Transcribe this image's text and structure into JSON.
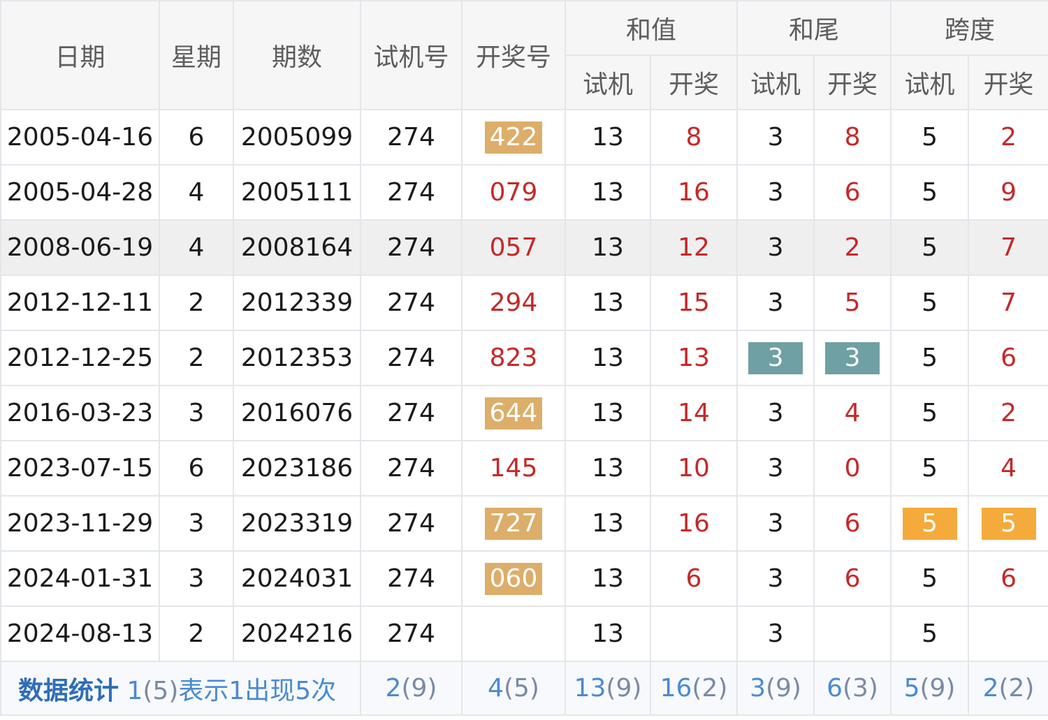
{
  "headers": {
    "date": "日期",
    "weekday": "星期",
    "issue": "期数",
    "test_no": "试机号",
    "draw_no": "开奖号",
    "sum": "和值",
    "sum_tail": "和尾",
    "span": "跨度",
    "sub_test": "试机",
    "sub_draw": "开奖"
  },
  "rows": [
    {
      "date": "2005-04-16",
      "weekday": "6",
      "issue": "2005099",
      "test": "274",
      "draw": "422",
      "draw_badge": "sand",
      "sum_test": "13",
      "sum_draw": "8",
      "tail_test": "3",
      "tail_draw": "8",
      "span_test": "5",
      "span_draw": "2"
    },
    {
      "date": "2005-04-28",
      "weekday": "4",
      "issue": "2005111",
      "test": "274",
      "draw": "079",
      "draw_badge": "",
      "sum_test": "13",
      "sum_draw": "16",
      "tail_test": "3",
      "tail_draw": "6",
      "span_test": "5",
      "span_draw": "9"
    },
    {
      "date": "2008-06-19",
      "weekday": "4",
      "issue": "2008164",
      "test": "274",
      "draw": "057",
      "draw_badge": "",
      "sum_test": "13",
      "sum_draw": "12",
      "tail_test": "3",
      "tail_draw": "2",
      "span_test": "5",
      "span_draw": "7",
      "highlight": true
    },
    {
      "date": "2012-12-11",
      "weekday": "2",
      "issue": "2012339",
      "test": "274",
      "draw": "294",
      "draw_badge": "",
      "sum_test": "13",
      "sum_draw": "15",
      "tail_test": "3",
      "tail_draw": "5",
      "span_test": "5",
      "span_draw": "7"
    },
    {
      "date": "2012-12-25",
      "weekday": "2",
      "issue": "2012353",
      "test": "274",
      "draw": "823",
      "draw_badge": "",
      "sum_test": "13",
      "sum_draw": "13",
      "tail_test": "3",
      "tail_draw": "3",
      "tail_badge": "teal",
      "span_test": "5",
      "span_draw": "6"
    },
    {
      "date": "2016-03-23",
      "weekday": "3",
      "issue": "2016076",
      "test": "274",
      "draw": "644",
      "draw_badge": "sand",
      "sum_test": "13",
      "sum_draw": "14",
      "tail_test": "3",
      "tail_draw": "4",
      "span_test": "5",
      "span_draw": "2"
    },
    {
      "date": "2023-07-15",
      "weekday": "6",
      "issue": "2023186",
      "test": "274",
      "draw": "145",
      "draw_badge": "",
      "sum_test": "13",
      "sum_draw": "10",
      "tail_test": "3",
      "tail_draw": "0",
      "span_test": "5",
      "span_draw": "4"
    },
    {
      "date": "2023-11-29",
      "weekday": "3",
      "issue": "2023319",
      "test": "274",
      "draw": "727",
      "draw_badge": "sand",
      "sum_test": "13",
      "sum_draw": "16",
      "tail_test": "3",
      "tail_draw": "6",
      "span_test": "5",
      "span_draw": "5",
      "span_badge": "orange"
    },
    {
      "date": "2024-01-31",
      "weekday": "3",
      "issue": "2024031",
      "test": "274",
      "draw": "060",
      "draw_badge": "sand",
      "sum_test": "13",
      "sum_draw": "6",
      "tail_test": "3",
      "tail_draw": "6",
      "span_test": "5",
      "span_draw": "6"
    },
    {
      "date": "2024-08-13",
      "weekday": "2",
      "issue": "2024216",
      "test": "274",
      "draw": "",
      "draw_badge": "",
      "sum_test": "13",
      "sum_draw": "",
      "tail_test": "3",
      "tail_draw": "",
      "span_test": "5",
      "span_draw": ""
    }
  ],
  "footer": {
    "label": "数据统计",
    "note_key": "1",
    "note_cnt": "(5)",
    "note_text": "表示1出现5次",
    "stats": [
      {
        "key": "2",
        "cnt": "(9)"
      },
      {
        "key": "4",
        "cnt": "(5)"
      },
      {
        "key": "13",
        "cnt": "(9)"
      },
      {
        "key": "16",
        "cnt": "(2)"
      },
      {
        "key": "3",
        "cnt": "(9)"
      },
      {
        "key": "6",
        "cnt": "(3)"
      },
      {
        "key": "5",
        "cnt": "(9)"
      },
      {
        "key": "2",
        "cnt": "(2)"
      }
    ]
  },
  "colors": {
    "draw_red": "#c62828",
    "badge_sand": "#dcae6a",
    "badge_teal": "#6fa0a3",
    "badge_orange": "#f4ab3c",
    "footer_blue": "#3d70ad"
  }
}
